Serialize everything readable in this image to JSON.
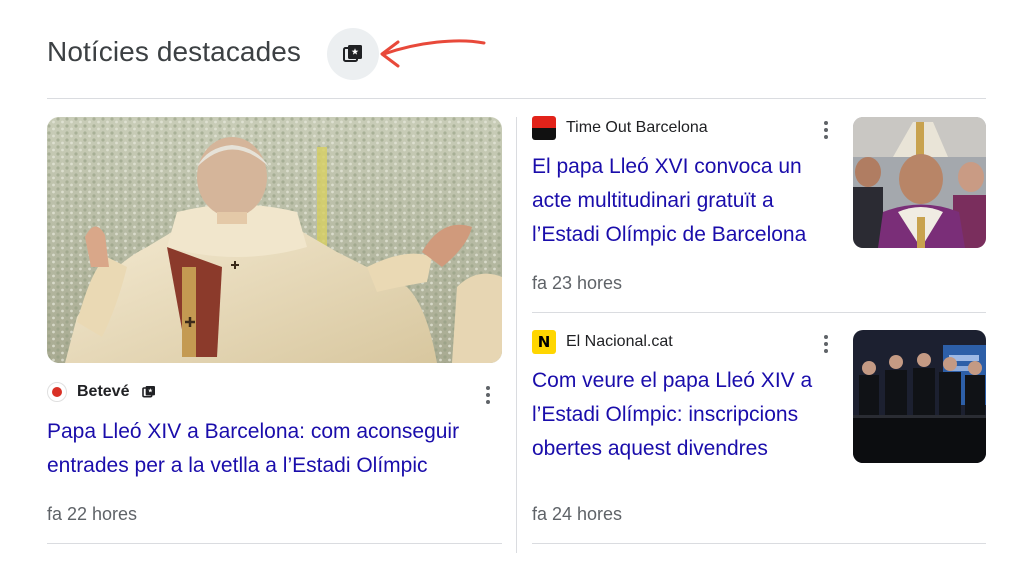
{
  "header": {
    "title": "Notícies destacades",
    "icon": "full-coverage-icon",
    "annotation": "red-arrow"
  },
  "featured": {
    "image": "pope-blessing-crowd-photo",
    "source": {
      "name": "Betevé",
      "logo": "betev-logo",
      "badge_icon": "full-coverage-icon"
    },
    "headline": "Papa Lleó XIV a Barcelona: com aconseguir entrades per a la vetlla a l’Estadi Olímpic",
    "time": "fa 22 hores"
  },
  "articles": [
    {
      "source": {
        "name": "Time Out Barcelona",
        "logo": "timeout-logo"
      },
      "headline": "El papa Lleó XVI convoca un acte multitudinari gratuït a l’Estadi Olímpic de Barcelona",
      "time": "fa 23 hores",
      "image": "cardinals-portrait-photo"
    },
    {
      "source": {
        "name": "El Nacional.cat",
        "logo": "elnacional-logo",
        "logo_letter": "N"
      },
      "headline": "Com veure el papa Lleó XIV a l’Estadi Olímpic: inscripcions obertes aquest divendres",
      "time": "fa 24 hores",
      "image": "press-conference-photo"
    }
  ],
  "colors": {
    "headline": "#1a0dab",
    "secondary_text": "#5f6368",
    "divider": "#dadce0",
    "arrow": "#e8493a"
  }
}
